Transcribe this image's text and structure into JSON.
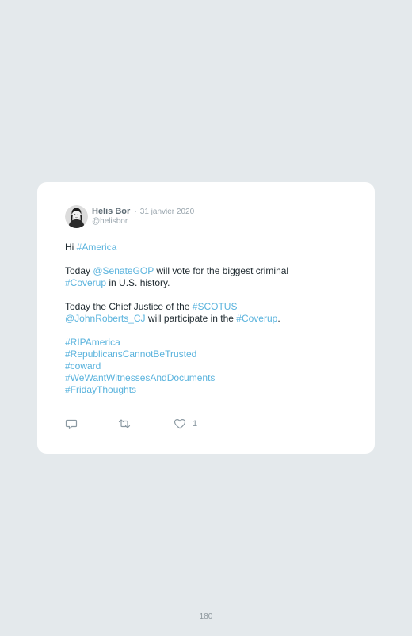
{
  "tweet": {
    "author_name": "Helis Bor",
    "separator": "·",
    "date": "31 janvier 2020",
    "handle": "@helisbor",
    "body": {
      "p1": {
        "t1": "Hi ",
        "l1": "#America"
      },
      "p2": {
        "t1": "Today ",
        "l1": "@SenateGOP",
        "t2": " will vote for the biggest criminal",
        "l2": "#Coverup",
        "t3": " in U.S. history."
      },
      "p3": {
        "t1": "Today the Chief Justice of the ",
        "l1": "#SCOTUS",
        "l2": "@JohnRoberts_CJ",
        "t2": " will participate in the ",
        "l3": "#Coverup",
        "t3": "."
      },
      "hashtags": [
        "#RIPAmerica",
        "#RepublicansCannotBeTrusted",
        "#coward",
        "#WeWantWitnessesAndDocuments",
        "#FridayThoughts"
      ]
    },
    "actions": {
      "reply_icon": "reply-icon",
      "retweet_icon": "retweet-icon",
      "like_icon": "heart-icon",
      "like_count": "1"
    }
  },
  "page": {
    "number": "180"
  },
  "colors": {
    "background": "#e4e9ec",
    "card": "#ffffff",
    "link": "#5ab3dd",
    "text": "#1f2a30",
    "muted": "#99a5ad"
  }
}
